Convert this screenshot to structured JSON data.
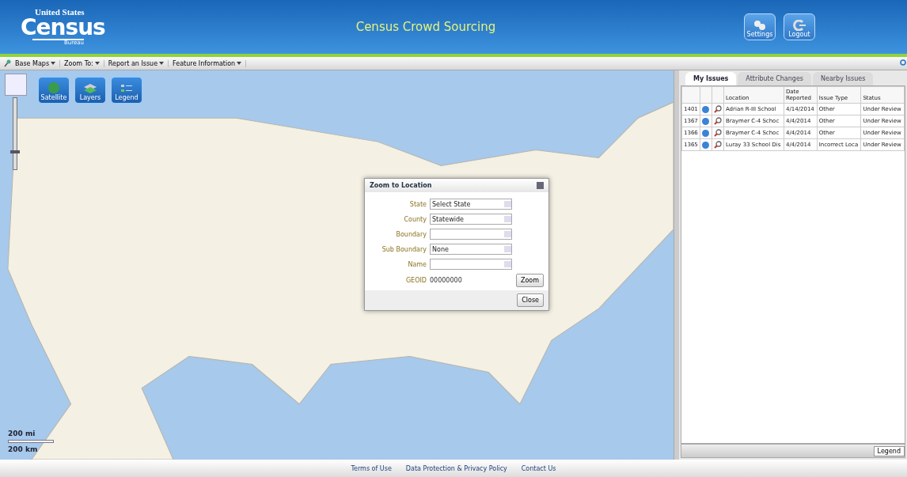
{
  "header": {
    "logo": {
      "top": "United States",
      "main": "Census",
      "bottom": "Bureau"
    },
    "title": "Census Crowd Sourcing",
    "buttons": [
      {
        "kind": "settings",
        "label": "Settings"
      },
      {
        "kind": "logout",
        "label": "Logout"
      }
    ]
  },
  "toolbar": {
    "menus": [
      "Base Maps",
      "Zoom To:",
      "Report an Issue",
      "Feature Information"
    ]
  },
  "map": {
    "tools": [
      {
        "kind": "satellite",
        "label": "Satellite"
      },
      {
        "kind": "layers",
        "label": "Layers"
      },
      {
        "kind": "legend",
        "label": "Legend"
      }
    ],
    "zoom_slider": {
      "level": 0.25
    },
    "scale": [
      "200 mi",
      "200 km"
    ]
  },
  "dialog": {
    "title": "Zoom to Location",
    "fields": [
      {
        "label": "State",
        "value": "Select State"
      },
      {
        "label": "County",
        "value": "Statewide"
      },
      {
        "label": "Boundary"
      },
      {
        "label": "Sub Boundary",
        "value": "None"
      },
      {
        "label": "Name"
      }
    ],
    "geoid": {
      "label": "GEOID",
      "value": "00000000"
    },
    "buttons": [
      "Zoom",
      "Close"
    ]
  },
  "panel": {
    "tabs": [
      {
        "label": "My Issues",
        "selected": true
      },
      {
        "label": "Attribute Changes",
        "selected": false
      },
      {
        "label": "Nearby Issues",
        "selected": false
      }
    ],
    "columns": [
      "Location",
      "Date Reported",
      "Issue Type",
      "Status"
    ],
    "rows": [
      {
        "id": "1401",
        "location": "Adrian R-III School",
        "date": "4/14/2014",
        "type": "Other",
        "status": "Under Review"
      },
      {
        "id": "1367",
        "location": "Braymer C-4 Schoc",
        "date": "4/4/2014",
        "type": "Other",
        "status": "Under Review"
      },
      {
        "id": "1366",
        "location": "Braymer C-4 Schoc",
        "date": "4/4/2014",
        "type": "Other",
        "status": "Under Review"
      },
      {
        "id": "1365",
        "location": "Luray 33 School Dis",
        "date": "4/4/2014",
        "type": "Incorrect Loca",
        "status": "Under Review"
      }
    ],
    "legend_button": "Legend"
  },
  "footer": {
    "links": [
      "Terms of Use",
      "Data Protection & Privacy Policy",
      "Contact Us"
    ]
  }
}
